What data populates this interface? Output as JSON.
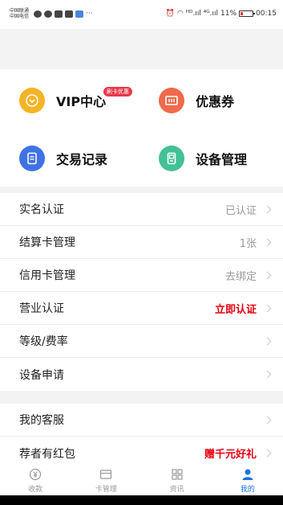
{
  "status_bar": {
    "carrier_line1": "中国联通",
    "carrier_line2": "中国电信",
    "more": "···",
    "signal_info": "ᴴᴰ.ııl ⁴ᴳ.ııl",
    "battery_percent": "11%",
    "time": "00:15"
  },
  "shortcuts": [
    {
      "label": "VIP中心",
      "icon": "heart-icon",
      "color": "#f5b326"
    },
    {
      "label": "优惠券",
      "icon": "coupon-icon",
      "color": "#ef6a4a"
    },
    {
      "label": "交易记录",
      "icon": "document-icon",
      "color": "#3f72e6"
    },
    {
      "label": "设备管理",
      "icon": "device-icon",
      "color": "#43c196"
    }
  ],
  "vip_badge": "刷卡优惠",
  "group1": [
    {
      "label": "实名认证",
      "value": "已认证"
    },
    {
      "label": "结算卡管理",
      "value": "1张"
    },
    {
      "label": "信用卡管理",
      "value": "去绑定"
    },
    {
      "label": "营业认证",
      "value": "立即认证"
    },
    {
      "label": "等级/费率",
      "value": ""
    },
    {
      "label": "设备申请",
      "value": ""
    }
  ],
  "group2": [
    {
      "label": "我的客服",
      "value": ""
    },
    {
      "label": "荐者有红包",
      "value": "赠千元好礼"
    }
  ],
  "tabs": [
    {
      "label": "收款",
      "icon": "yuan-icon"
    },
    {
      "label": "卡管理",
      "icon": "card-icon"
    },
    {
      "label": "资讯",
      "icon": "grid-icon"
    },
    {
      "label": "我的",
      "icon": "user-icon",
      "active": true
    }
  ],
  "colors": {
    "accent": "#1a73e8",
    "highlight_red": "#e60012"
  }
}
